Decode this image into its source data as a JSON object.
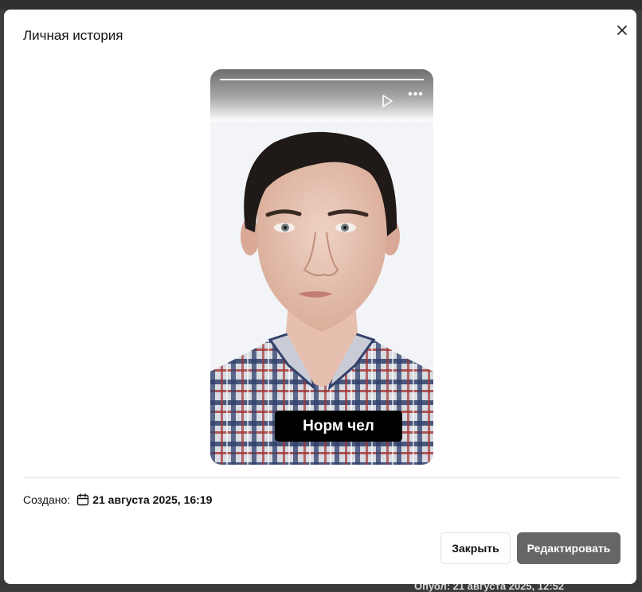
{
  "modal": {
    "title": "Личная история",
    "close_icon": "close-icon"
  },
  "story": {
    "play_icon": "play-icon",
    "more_icon": "more-horizontal-icon",
    "more_glyph": "•••",
    "caption": "Норм чел",
    "progress": 1.0
  },
  "meta": {
    "created_label": "Создано:",
    "calendar_icon": "calendar-icon",
    "created_date": "21 августа 2025, 16:19"
  },
  "footer": {
    "close_label": "Закрыть",
    "edit_label": "Редактировать"
  },
  "background": {
    "partial_text": "Опуол:  21 августа 2025, 12:52"
  },
  "colors": {
    "primary_button": "#666666",
    "caption_bg": "#000000"
  }
}
